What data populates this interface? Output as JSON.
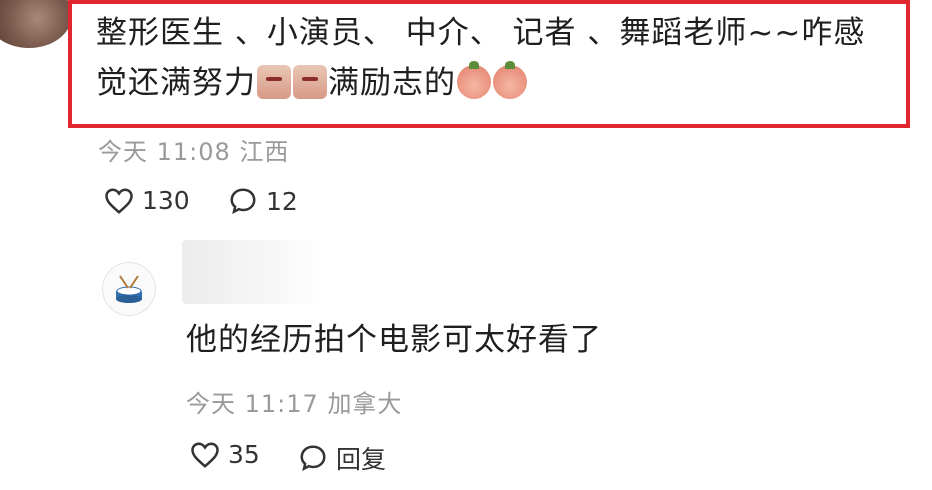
{
  "comment1": {
    "text_line1": "整形医生 、小演员、 中介、 记者 、舞蹈老师~~咋感",
    "text_line2_a": "觉还满努力",
    "text_line2_b": "满励志的",
    "time": "今天 11:08",
    "location": "江西",
    "likes": "130",
    "replies": "12"
  },
  "comment2": {
    "text": "他的经历拍个电影可太好看了",
    "time": "今天 11:17",
    "location": "加拿大",
    "likes": "35",
    "reply_label": "回复"
  },
  "icons": {
    "like": "heart-outline-icon",
    "reply": "speech-bubble-icon",
    "avatar2": "drum-icon",
    "emoji1": "embarrassed-face-emoji",
    "emoji2": "blushing-face-emoji"
  },
  "colors": {
    "highlight": "#e0262f",
    "meta_text": "#9a9a9a"
  }
}
